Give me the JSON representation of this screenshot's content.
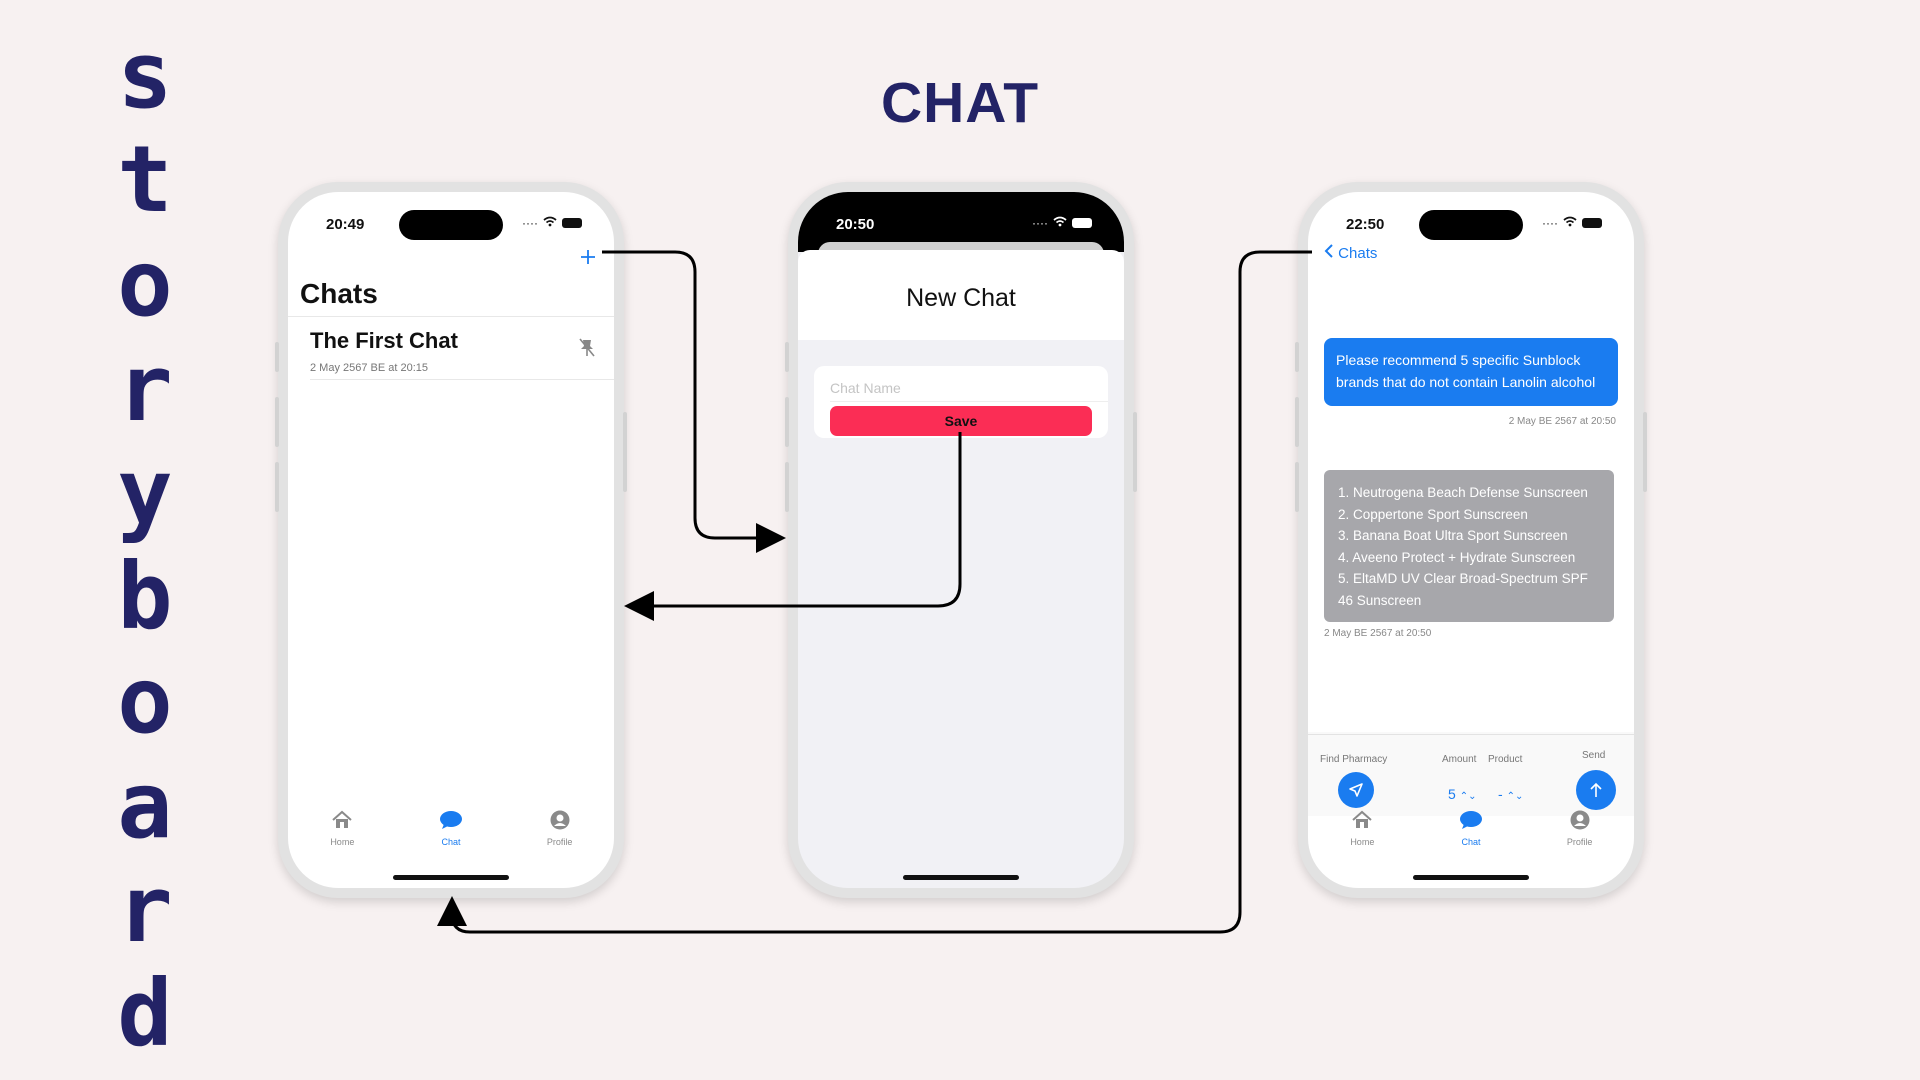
{
  "side_title": [
    "S",
    "t",
    "o",
    "r",
    "y",
    "b",
    "o",
    "a",
    "r",
    "d"
  ],
  "title": "CHAT",
  "colors": {
    "accent": "#1a7cf0",
    "save": "#fb2d55",
    "title": "#232366",
    "bot_bubble": "#a7a7ab"
  },
  "tabs": [
    {
      "icon": "house-icon",
      "label": "Home"
    },
    {
      "icon": "chat-bubble-icon",
      "label": "Chat"
    },
    {
      "icon": "person-circle-icon",
      "label": "Profile"
    }
  ],
  "phone1": {
    "time": "20:49",
    "add_icon": "plus-icon",
    "heading": "Chats",
    "chats": [
      {
        "title": "The First Chat",
        "date": "2 May 2567 BE at 20:15",
        "icon": "pin-slash-icon"
      }
    ]
  },
  "phone2": {
    "time": "20:50",
    "heading": "New Chat",
    "chat_name_placeholder": "Chat Name",
    "save_label": "Save"
  },
  "phone3": {
    "time": "22:50",
    "back_label": "Chats",
    "user_message": "Please recommend 5 specific Sunblock brands that do not contain Lanolin alcohol",
    "user_timestamp": "2 May BE 2567 at 20:50",
    "bot_lines": [
      "1. Neutrogena Beach Defense Sunscreen",
      "2. Coppertone Sport Sunscreen",
      "3. Banana Boat Ultra Sport Sunscreen",
      "4. Aveeno Protect + Hydrate Sunscreen",
      "5. EltaMD UV Clear Broad-Spectrum SPF",
      "46 Sunscreen"
    ],
    "bot_timestamp": "2 May BE 2567 at 20:50",
    "find_pharmacy_label": "Find Pharmacy",
    "amount_label": "Amount",
    "amount_value": "5",
    "product_label": "Product",
    "product_value": "-",
    "send_label": "Send"
  }
}
